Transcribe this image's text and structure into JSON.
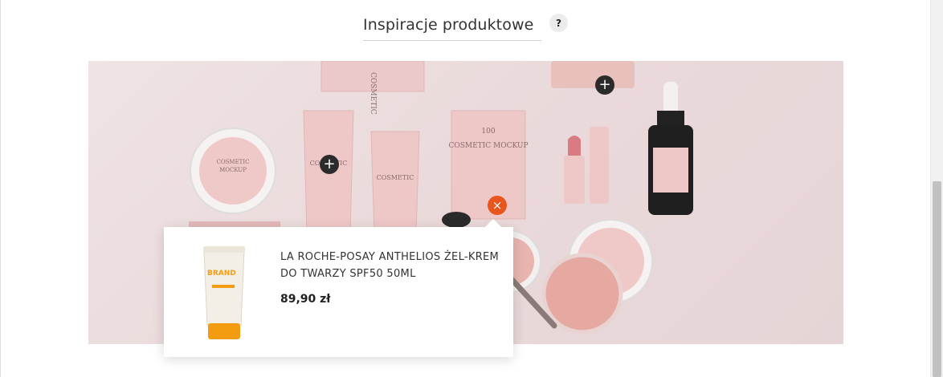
{
  "section": {
    "title": "Inspiracje produktowe",
    "help_label": "?"
  },
  "hotspots": [
    {
      "icon": "plus-icon",
      "label": "+"
    },
    {
      "icon": "plus-icon",
      "label": "+"
    },
    {
      "icon": "close-icon",
      "label": "×"
    }
  ],
  "product_popup": {
    "name": "LA ROCHE-POSAY ANTHELIOS ŻEL-KREM DO TWARZY SPF50 50ML",
    "price": "89,90 zł",
    "image_brand": "BRAND"
  },
  "mockup_labels": {
    "brand_big": "COSMETIC MOCKUP",
    "number": "100"
  },
  "colors": {
    "accent": "#e8551e",
    "hotspot": "#2b2b2b",
    "banner_bg": "#ead9da"
  }
}
